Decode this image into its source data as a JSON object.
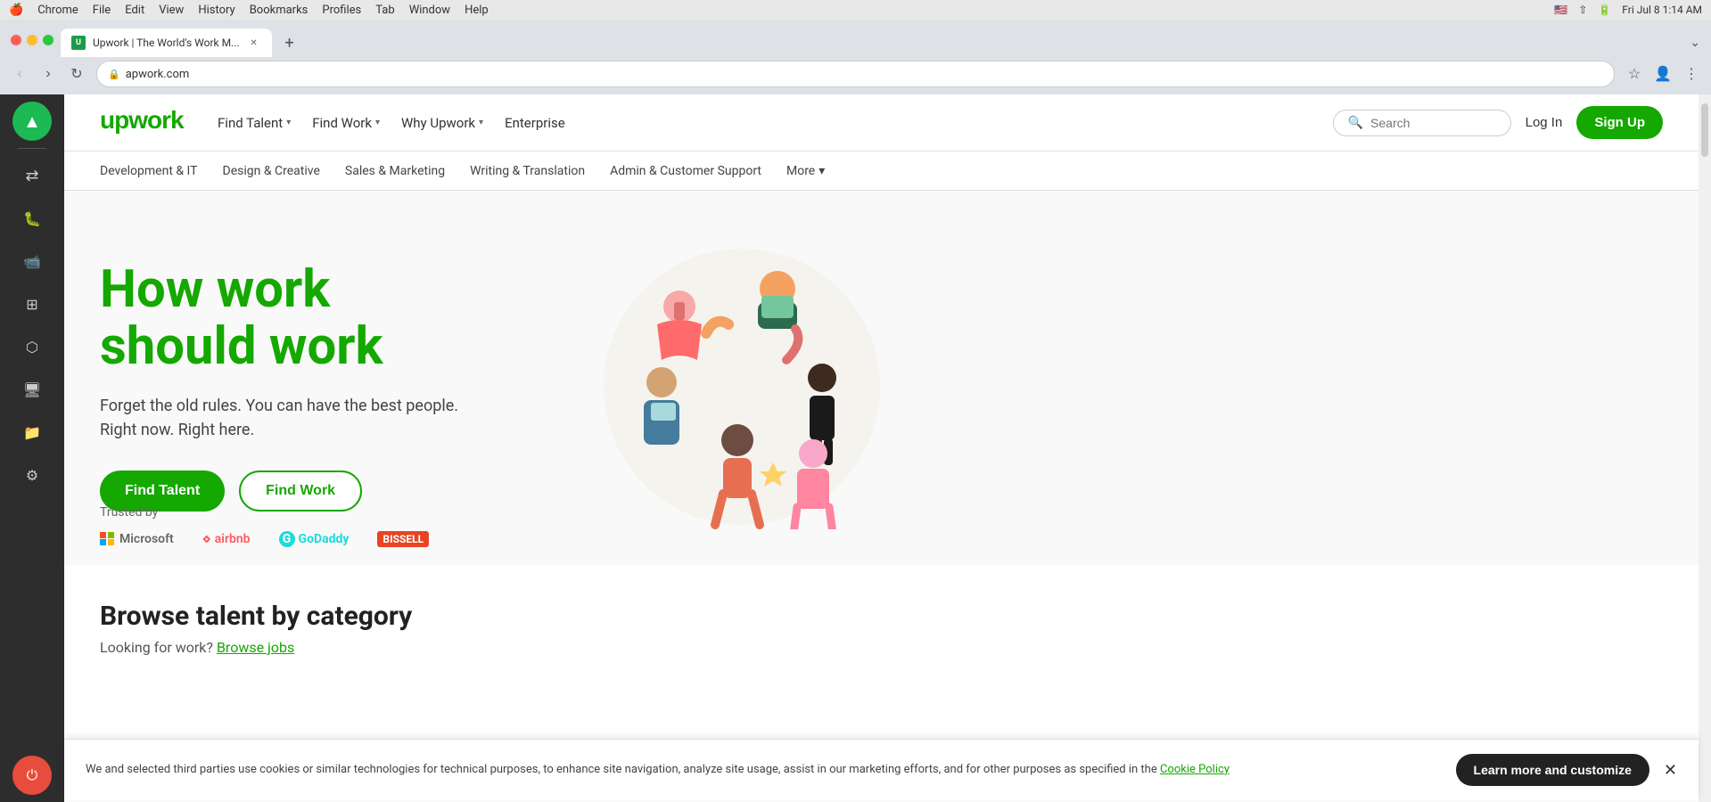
{
  "macbar": {
    "apple": "🍎",
    "menus": [
      "Chrome",
      "File",
      "Edit",
      "View",
      "History",
      "Bookmarks",
      "Profiles",
      "Tab",
      "Window",
      "Help"
    ],
    "datetime": "Fri Jul 8  1:14 AM"
  },
  "browser": {
    "tab_title": "Upwork | The World's Work M...",
    "url": "apwork.com",
    "new_tab": "+",
    "back_disabled": true
  },
  "dock": {
    "items": [
      {
        "id": "up-arrow",
        "symbol": "▲",
        "active": true
      },
      {
        "id": "network",
        "symbol": "⇄"
      },
      {
        "id": "bug",
        "symbol": "🐛"
      },
      {
        "id": "camera",
        "symbol": "📷"
      },
      {
        "id": "layers",
        "symbol": "⊞"
      },
      {
        "id": "box",
        "symbol": "⬡"
      },
      {
        "id": "display",
        "symbol": "🖥"
      },
      {
        "id": "folder",
        "symbol": "📁"
      },
      {
        "id": "settings",
        "symbol": "⚙"
      },
      {
        "id": "power",
        "symbol": "⏻",
        "power": true
      }
    ]
  },
  "upwork": {
    "logo": "upwork",
    "nav": {
      "find_talent": "Find Talent",
      "find_work": "Find Work",
      "why_upwork": "Why Upwork",
      "enterprise": "Enterprise"
    },
    "search_placeholder": "Search",
    "login": "Log In",
    "signup": "Sign Up",
    "categories": [
      "Development & IT",
      "Design & Creative",
      "Sales & Marketing",
      "Writing & Translation",
      "Admin & Customer Support",
      "More"
    ],
    "hero": {
      "title_line1": "How work",
      "title_line2": "should work",
      "subtitle": "Forget the old rules. You can have the best people.\nRight now. Right here.",
      "btn_talent": "Find Talent",
      "btn_work": "Find Work"
    },
    "trusted": {
      "label": "Trusted by",
      "logos": [
        "Microsoft",
        "airbnb",
        "GoDaddy",
        "BISSELL"
      ]
    },
    "browse": {
      "title": "Browse talent by category",
      "subtitle": "Looking for work?",
      "link": "Browse jobs"
    }
  },
  "cookie": {
    "text": "We and selected third parties use cookies or similar technologies for technical purposes, to enhance site navigation, analyze site usage, assist in our marketing efforts, and for other purposes as specified in the",
    "link_text": "Cookie Policy",
    "btn_label": "Learn more and customize"
  }
}
